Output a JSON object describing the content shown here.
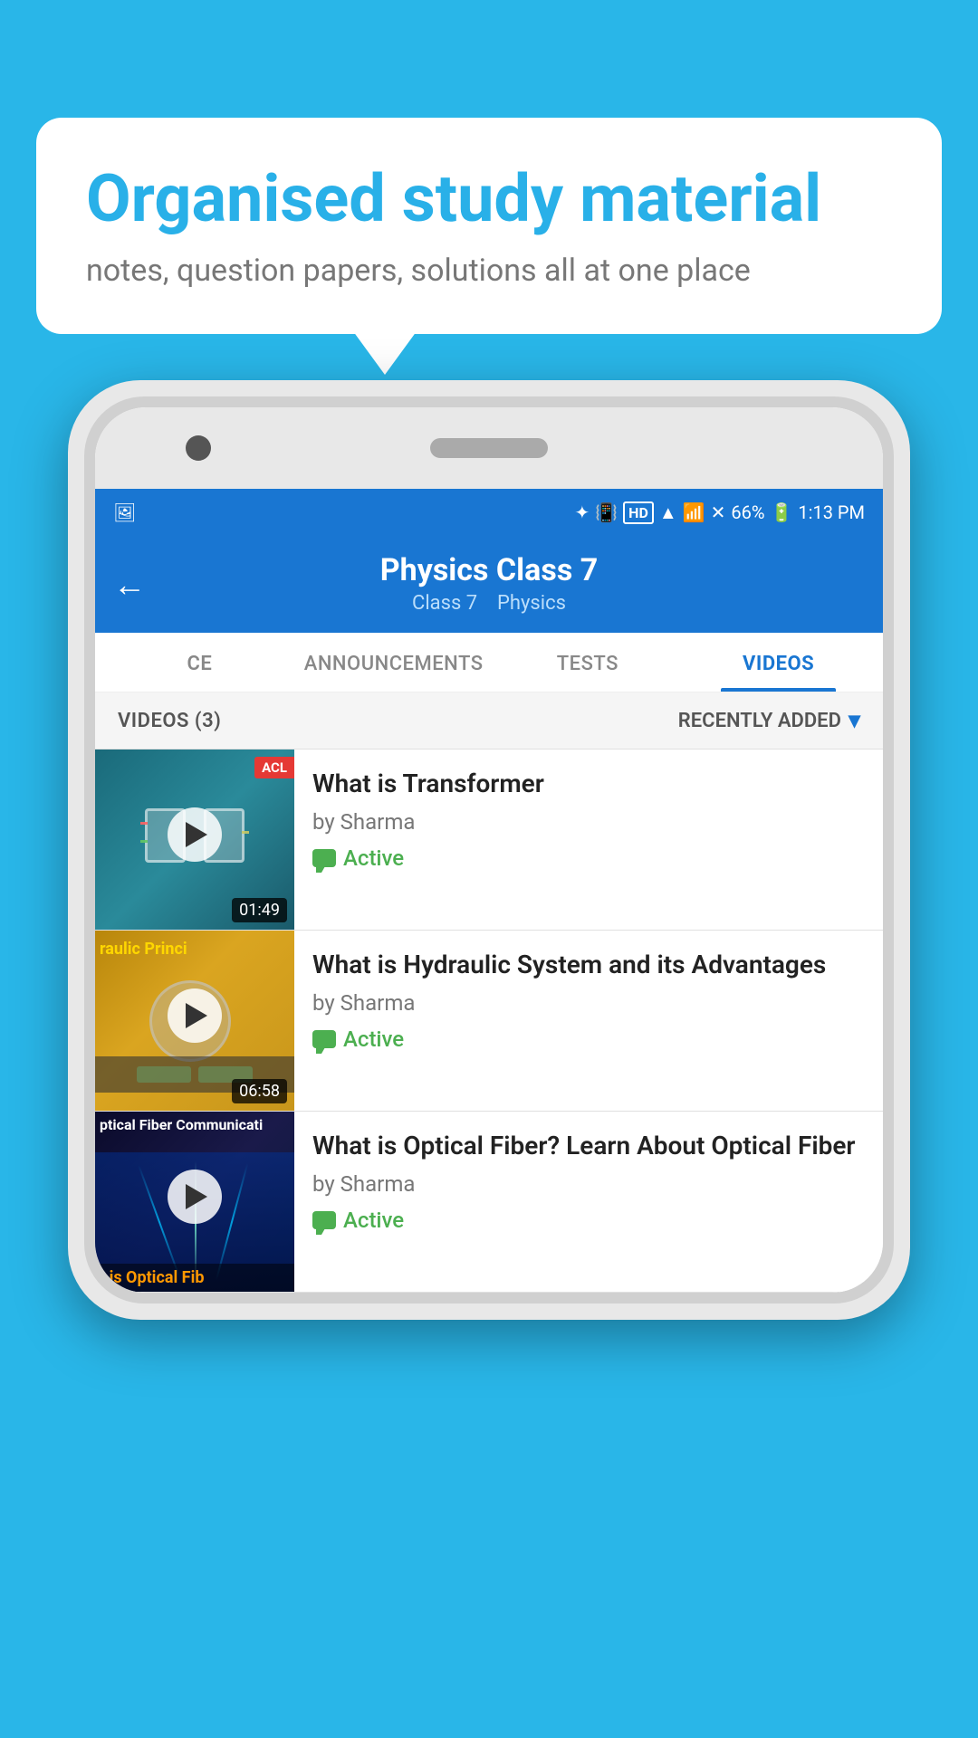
{
  "background_color": "#29b6e8",
  "speech_bubble": {
    "title": "Organised study material",
    "subtitle": "notes, question papers, solutions all at one place"
  },
  "status_bar": {
    "time": "1:13 PM",
    "battery": "66%",
    "icons": [
      "bluetooth",
      "vibrate",
      "hd",
      "wifi",
      "signal",
      "no-signal"
    ]
  },
  "app_header": {
    "title": "Physics Class 7",
    "subtitle_class": "Class 7",
    "subtitle_subject": "Physics",
    "back_label": "←"
  },
  "tabs": [
    {
      "id": "ce",
      "label": "CE",
      "active": false
    },
    {
      "id": "announcements",
      "label": "ANNOUNCEMENTS",
      "active": false
    },
    {
      "id": "tests",
      "label": "TESTS",
      "active": false
    },
    {
      "id": "videos",
      "label": "VIDEOS",
      "active": true
    }
  ],
  "filter_bar": {
    "count_label": "VIDEOS (3)",
    "sort_label": "RECENTLY ADDED",
    "sort_icon": "▾"
  },
  "videos": [
    {
      "id": 1,
      "title": "What is  Transformer",
      "author": "by Sharma",
      "status": "Active",
      "duration": "01:49",
      "thumbnail_type": "dark_teal",
      "badge": "ACL"
    },
    {
      "id": 2,
      "title": "What is Hydraulic System and its Advantages",
      "author": "by Sharma",
      "status": "Active",
      "duration": "06:58",
      "thumbnail_type": "yellow",
      "thumbnail_text": "raulic Princi"
    },
    {
      "id": 3,
      "title": "What is Optical Fiber? Learn About Optical Fiber",
      "author": "by Sharma",
      "status": "Active",
      "duration": "",
      "thumbnail_type": "dark_blue",
      "thumbnail_text1": "ptical Fiber Communicati",
      "thumbnail_text2": "t is Optical Fib"
    }
  ],
  "chat_icon_label": "💬",
  "active_label": "Active"
}
